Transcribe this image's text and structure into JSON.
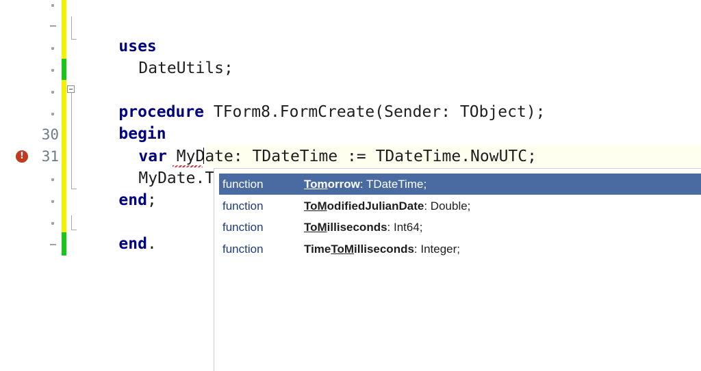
{
  "gutter": {
    "line_30": "30",
    "line_31": "31",
    "error_glyph": "!"
  },
  "code": {
    "line_uses_kw": "uses",
    "line_dateutils": "DateUtils;",
    "line_proc_kw": "procedure",
    "line_proc_rest": " TForm8.FormCreate(Sender: TObject);",
    "line_begin_kw": "begin",
    "line_var_kw": "var",
    "line_var_rest": " MyDate: TDateTime := TDateTime.NowUTC;",
    "line_typing": "MyDate.Tom",
    "line_end_kw": "end",
    "line_end_punct": ";",
    "line_enddot_kw": "end",
    "line_enddot_punct": "."
  },
  "completion": {
    "items": [
      {
        "kind": "function",
        "match": "Tom",
        "rest": "orrow",
        "prefix": "",
        "type": ": TDateTime;",
        "selected": true
      },
      {
        "kind": "function",
        "match": "ToM",
        "rest": "odifiedJulianDate",
        "prefix": "",
        "type": ": Double;",
        "selected": false
      },
      {
        "kind": "function",
        "match": "ToM",
        "rest": "illiseconds",
        "prefix": "",
        "type": ": Int64;",
        "selected": false
      },
      {
        "kind": "function",
        "match": "ToM",
        "rest": "illiseconds",
        "prefix": "Time",
        "type": ": Integer;",
        "selected": false
      }
    ]
  },
  "colors": {
    "keyword": "#000080",
    "selection": "#4a6aa2",
    "modified_bar": "#f2f200",
    "saved_bar": "#1cc51c",
    "error": "#c33a22"
  },
  "icons": {
    "error": "error-icon"
  }
}
